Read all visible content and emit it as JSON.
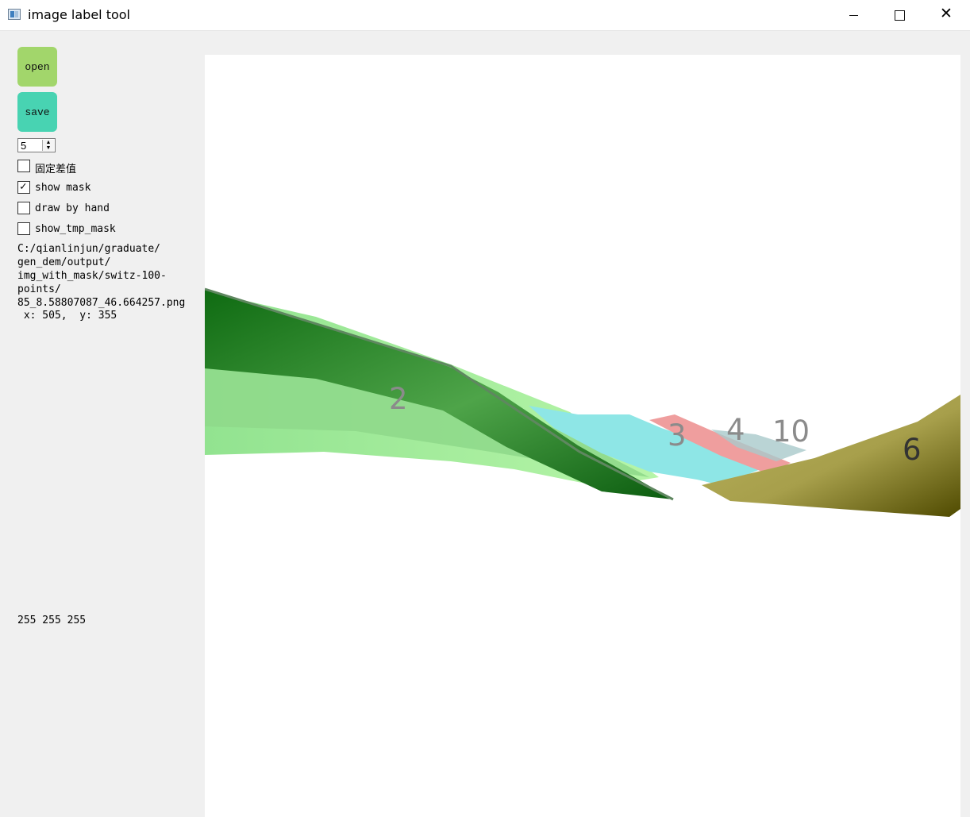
{
  "window": {
    "title": "image label tool",
    "minimize_icon": "minimize-icon",
    "maximize_icon": "maximize-icon",
    "close_icon": "close-icon"
  },
  "controls": {
    "open_label": "open",
    "save_label": "save",
    "spin_value": "5"
  },
  "checkboxes": [
    {
      "label": "固定差值",
      "checked": false
    },
    {
      "label": "show mask",
      "checked": true
    },
    {
      "label": "draw by hand",
      "checked": false
    },
    {
      "label": "show_tmp_mask",
      "checked": false
    }
  ],
  "info": {
    "path": "C:/qianlinjun/graduate/\ngen_dem/output/\nimg_with_mask/switz-100-\npoints/\n85_8.58807087_46.664257.png",
    "coordinates": " x: 505,  y: 355",
    "rgb": "255 255 255"
  },
  "canvas": {
    "labels": [
      "2",
      "3",
      "4",
      "10",
      "6"
    ],
    "colors": {
      "dark_green": "#0f6b12",
      "light_green": "#a8f5a1",
      "cyan": "#7fe0e2",
      "pink": "#ef9e9e",
      "olive": "#b9b35d",
      "background": "#ffffff"
    }
  }
}
